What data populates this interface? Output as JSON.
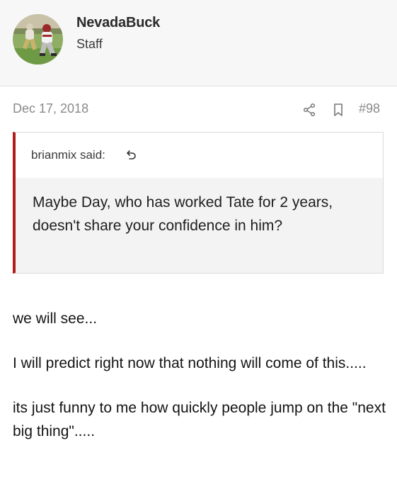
{
  "author": {
    "username": "NevadaBuck",
    "title": "Staff",
    "avatar_icon": "football-players-photo"
  },
  "post": {
    "date": "Dec 17, 2018",
    "number": "#98",
    "share_icon": "share-icon",
    "bookmark_icon": "bookmark-icon"
  },
  "quote": {
    "author_label": "brianmix said:",
    "jump_icon": "quote-jump-icon",
    "text": "Maybe Day, who has worked Tate for 2 years, doesn't share your confidence in him?",
    "accent_color": "#b31b1b"
  },
  "message": {
    "paragraphs": [
      "we will see...",
      "I will predict right now that nothing will come of this.....",
      "its just funny to me how quickly people jump on the \"next big thing\"....."
    ]
  }
}
